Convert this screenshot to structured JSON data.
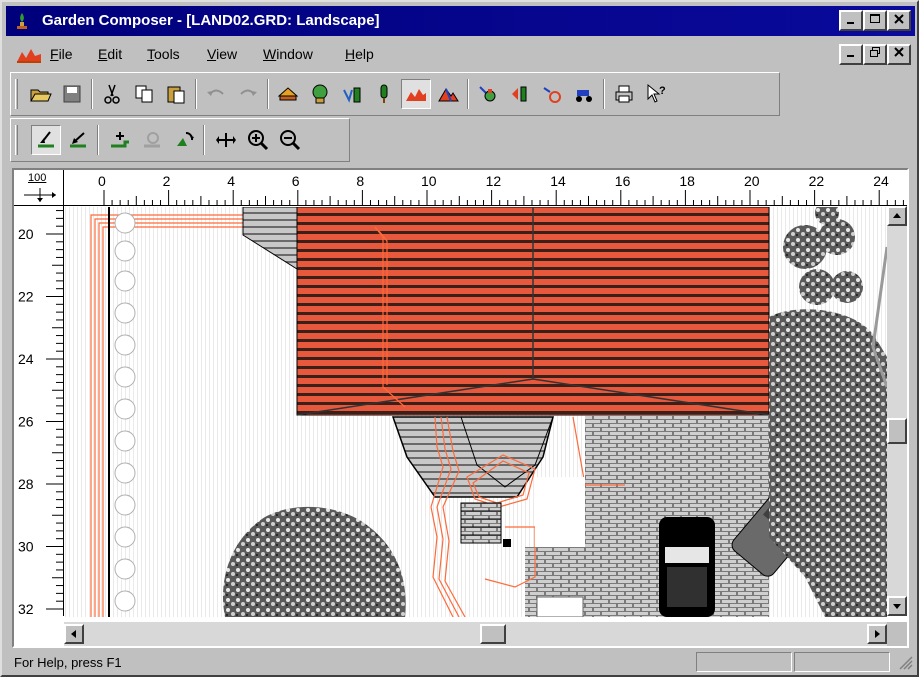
{
  "window": {
    "title": "Garden Composer - [LAND02.GRD: Landscape]",
    "caption_buttons": [
      "minimize",
      "maximize",
      "close"
    ]
  },
  "menu": {
    "items": [
      {
        "label": "File",
        "key": "F",
        "rest": "ile"
      },
      {
        "label": "Edit",
        "key": "E",
        "rest": "dit"
      },
      {
        "label": "Tools",
        "key": "T",
        "rest": "ools"
      },
      {
        "label": "View",
        "key": "V",
        "rest": "iew"
      },
      {
        "label": "Window",
        "key": "W",
        "rest": "indow"
      },
      {
        "label": "Help",
        "key": "H",
        "rest": "elp"
      }
    ]
  },
  "toolbar1": {
    "icons": [
      "open-icon",
      "save-icon",
      "cut-icon",
      "copy-icon",
      "paste-icon",
      "undo-icon",
      "redo-icon",
      "building-icon",
      "shrub-icon",
      "fence-icon",
      "tree-icon",
      "terrain-icon",
      "mountain-icon",
      "plant-add-icon",
      "move-plant-icon",
      "rotate-icon",
      "tractor-icon",
      "print-icon",
      "help-pointer-icon"
    ]
  },
  "toolbar2": {
    "icons": [
      "select-draw-icon",
      "select-edit-icon",
      "add-point-icon",
      "edit-point-icon",
      "rotate-object-icon",
      "pan-icon",
      "zoom-in-icon",
      "zoom-out-icon"
    ]
  },
  "ruler": {
    "corner_label": "100",
    "h_ticks": [
      "0",
      "2",
      "4",
      "6",
      "8",
      "10",
      "12",
      "14",
      "16",
      "18",
      "20",
      "22",
      "24"
    ],
    "v_ticks": [
      "20",
      "22",
      "24",
      "26",
      "28",
      "30",
      "32"
    ]
  },
  "status": {
    "text": "For Help, press F1"
  },
  "colors": {
    "titlebar": "#00007b",
    "roof": "#e8583c",
    "roof_stripe": "#2a1a14",
    "path_orange": "#ff6a3a",
    "brick": "#8a8a8a"
  }
}
